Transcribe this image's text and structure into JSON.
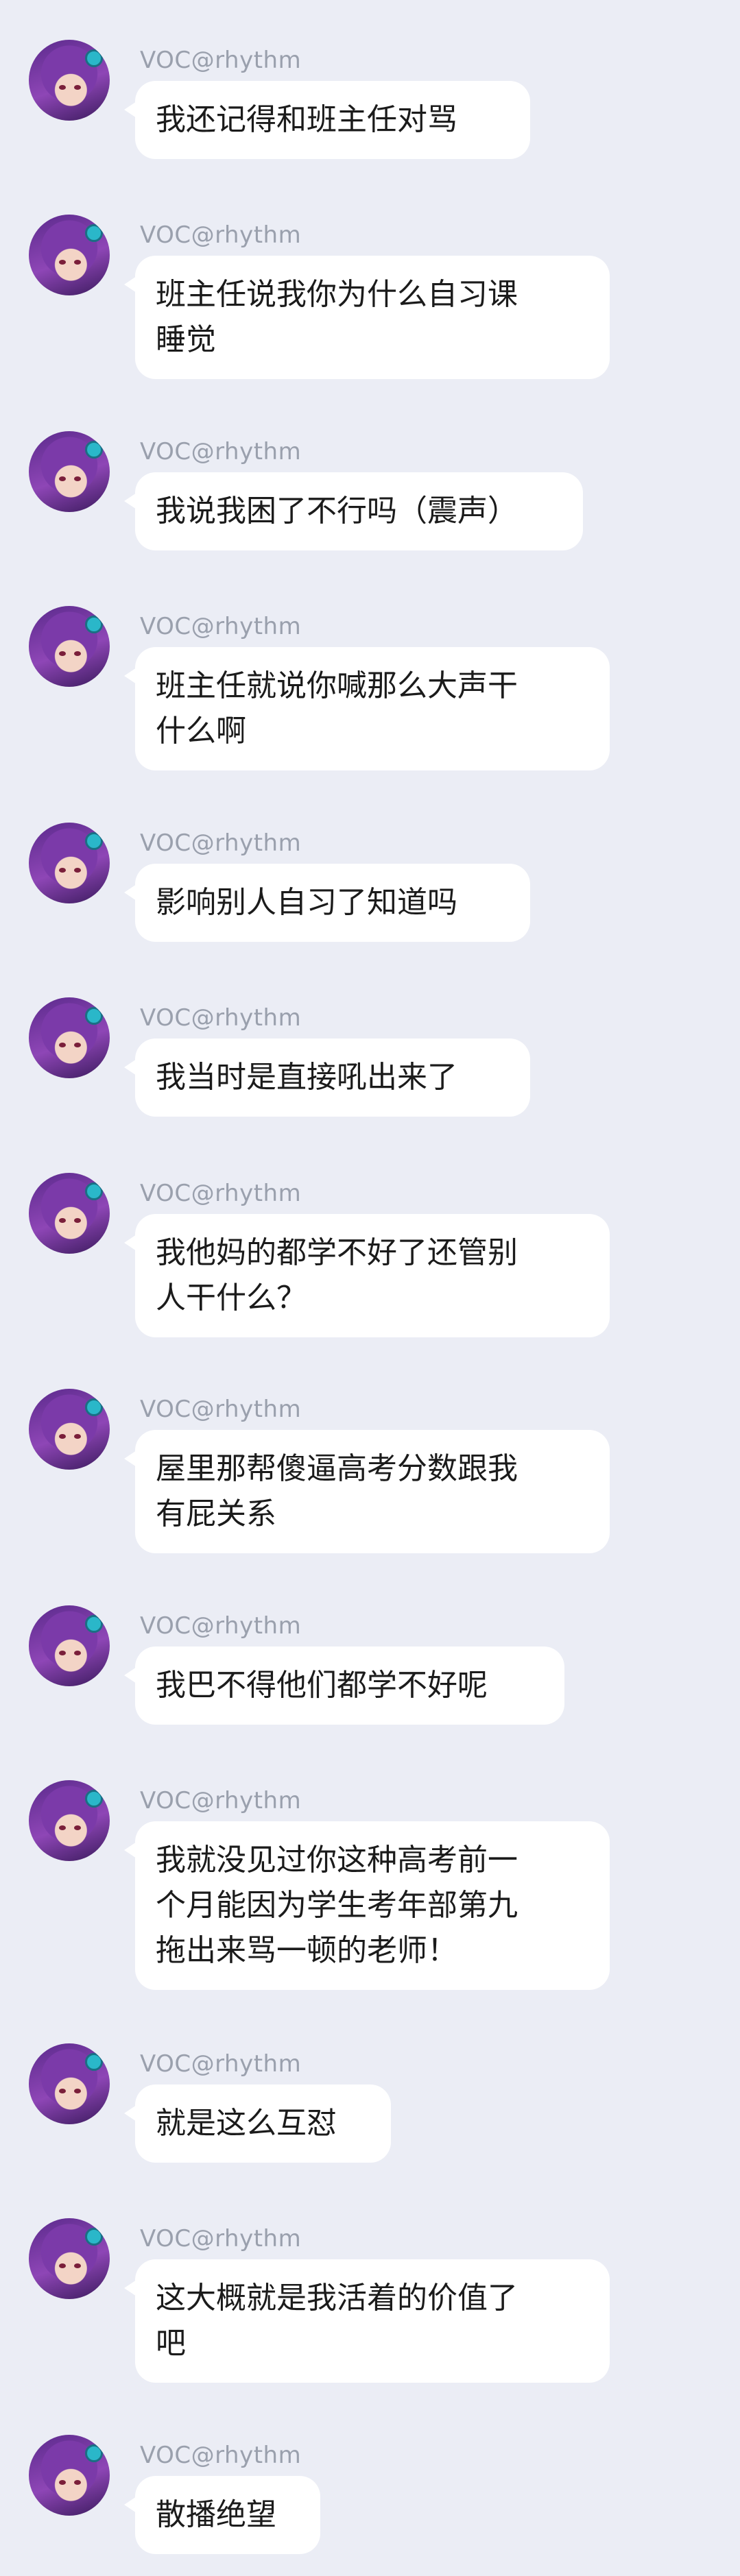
{
  "sender": "VOC@rhythm",
  "colors": {
    "background": "#ebedf5",
    "bubble": "#ffffff",
    "name_text": "#9aa0ad",
    "message_text": "#1b1b1b"
  },
  "messages": [
    {
      "text": "我还记得和班主任对骂"
    },
    {
      "text": "班主任说我你为什么自习课\n睡觉"
    },
    {
      "text": "我说我困了不行吗（震声）"
    },
    {
      "text": "班主任就说你喊那么大声干\n什么啊"
    },
    {
      "text": "影响别人自习了知道吗"
    },
    {
      "text": "我当时是直接吼出来了"
    },
    {
      "text": "我他妈的都学不好了还管别\n人干什么？"
    },
    {
      "text": "屋里那帮傻逼高考分数跟我\n有屁关系"
    },
    {
      "text": "我巴不得他们都学不好呢"
    },
    {
      "text": "我就没见过你这种高考前一\n个月能因为学生考年部第九\n拖出来骂一顿的老师！"
    },
    {
      "text": "就是这么互怼"
    },
    {
      "text": "这大概就是我活着的价值了\n吧"
    },
    {
      "text": "散播绝望"
    }
  ]
}
